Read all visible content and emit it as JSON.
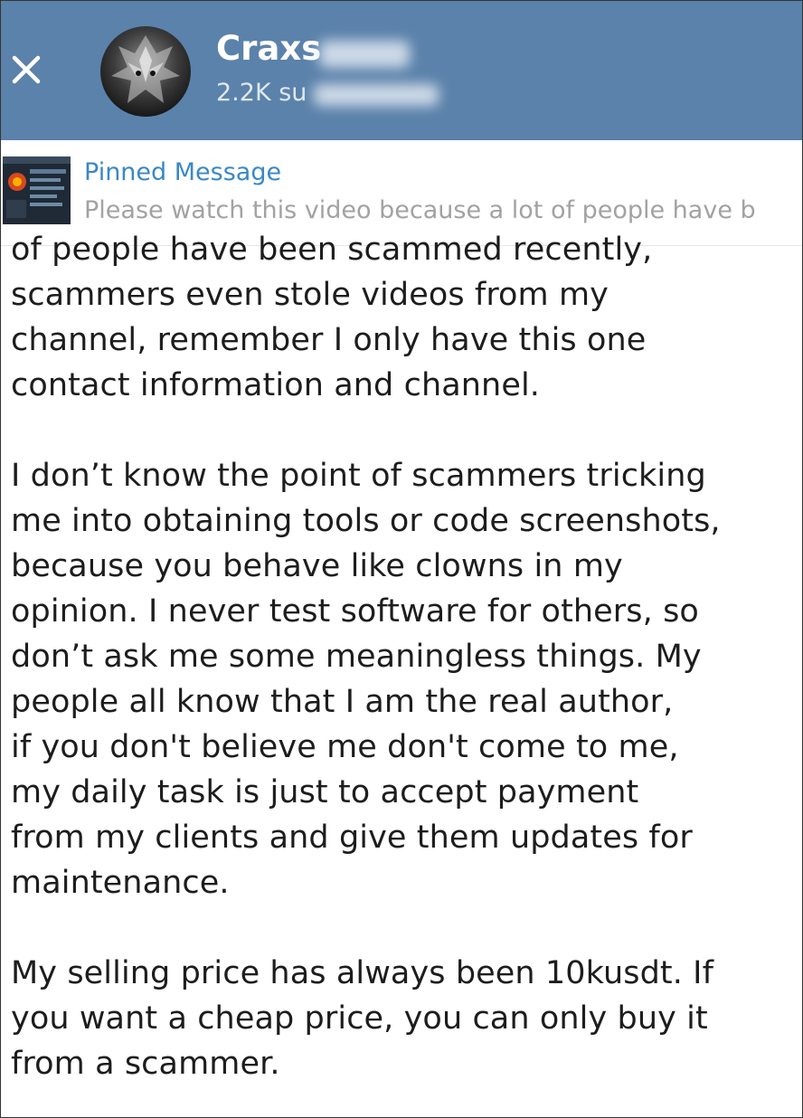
{
  "header": {
    "close_icon": "close-icon",
    "avatar_icon": "channel-avatar",
    "channel_name": "Craxs",
    "subscriber_text": "2.2K su",
    "background_color": "#5b82aa"
  },
  "pinned": {
    "title": "Pinned Message",
    "preview": "Please watch this video because a lot of people have b",
    "title_color": "#3a87c8"
  },
  "message": {
    "paragraphs": [
      {
        "lines": [
          "of people have been scammed recently,",
          "scammers even stole videos from my",
          "channel, remember I only have this one",
          "contact information and channel."
        ]
      },
      {
        "lines": [
          "I don’t know the point of scammers tricking",
          "me into obtaining tools or code screenshots,",
          "because you behave like clowns in my",
          "opinion. I never test software for others, so",
          "don’t ask me some meaningless things. My",
          "people all know that I am the real author,",
          "if you don't believe me don't come to me,",
          "my daily task is just to accept payment",
          "from my clients and give them updates for",
          "maintenance."
        ]
      },
      {
        "lines": [
          "My selling price has always been 10kusdt. If",
          "you want a cheap price, you can only buy it",
          "from a scammer."
        ]
      }
    ]
  }
}
